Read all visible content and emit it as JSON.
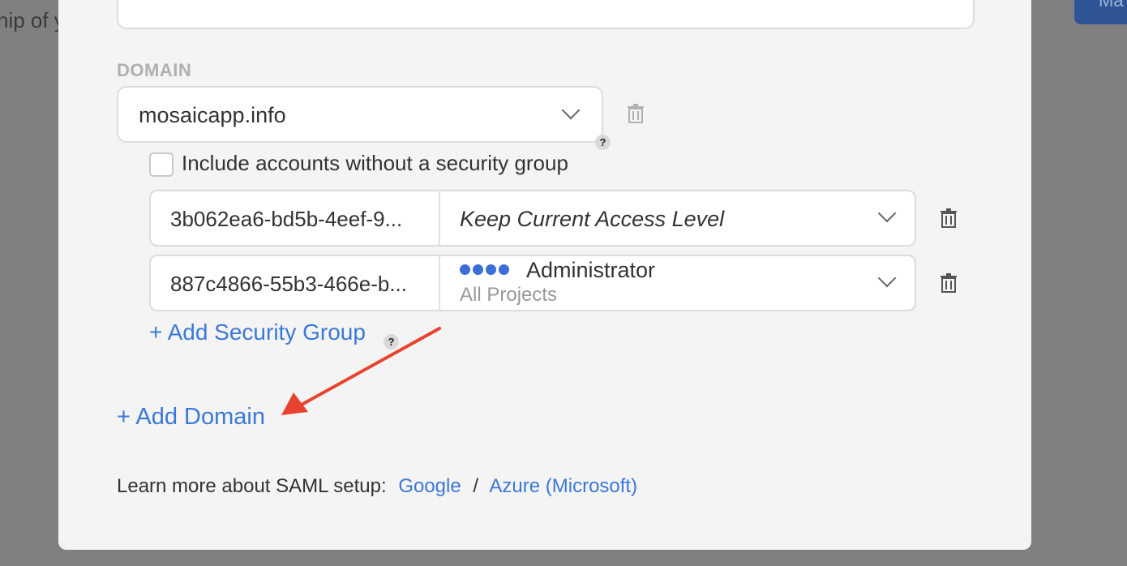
{
  "background": {
    "left_text": "hip of y",
    "button_label": "Ma"
  },
  "domain": {
    "section_label": "DOMAIN",
    "selected": "mosaicapp.info"
  },
  "include_accounts": {
    "label": "Include accounts without a security group",
    "checked": false,
    "help": "?"
  },
  "security_groups": [
    {
      "id": "3b062ea6-bd5b-4eef-9...",
      "access_label": "Keep Current Access Level"
    },
    {
      "id": "887c4866-55b3-466e-b...",
      "access_role": "Administrator",
      "access_scope": "All Projects",
      "level_dots": 4
    }
  ],
  "actions": {
    "add_security_group": "+ Add Security Group",
    "add_security_group_help": "?",
    "add_domain": "+ Add Domain"
  },
  "learn_more": {
    "text": "Learn more about SAML setup:",
    "separator": "/",
    "links": [
      "Google",
      "Azure (Microsoft)"
    ]
  },
  "colors": {
    "accent": "#3c78d8",
    "dots": "#3b6fd6",
    "annotation_arrow": "#e8432e"
  }
}
